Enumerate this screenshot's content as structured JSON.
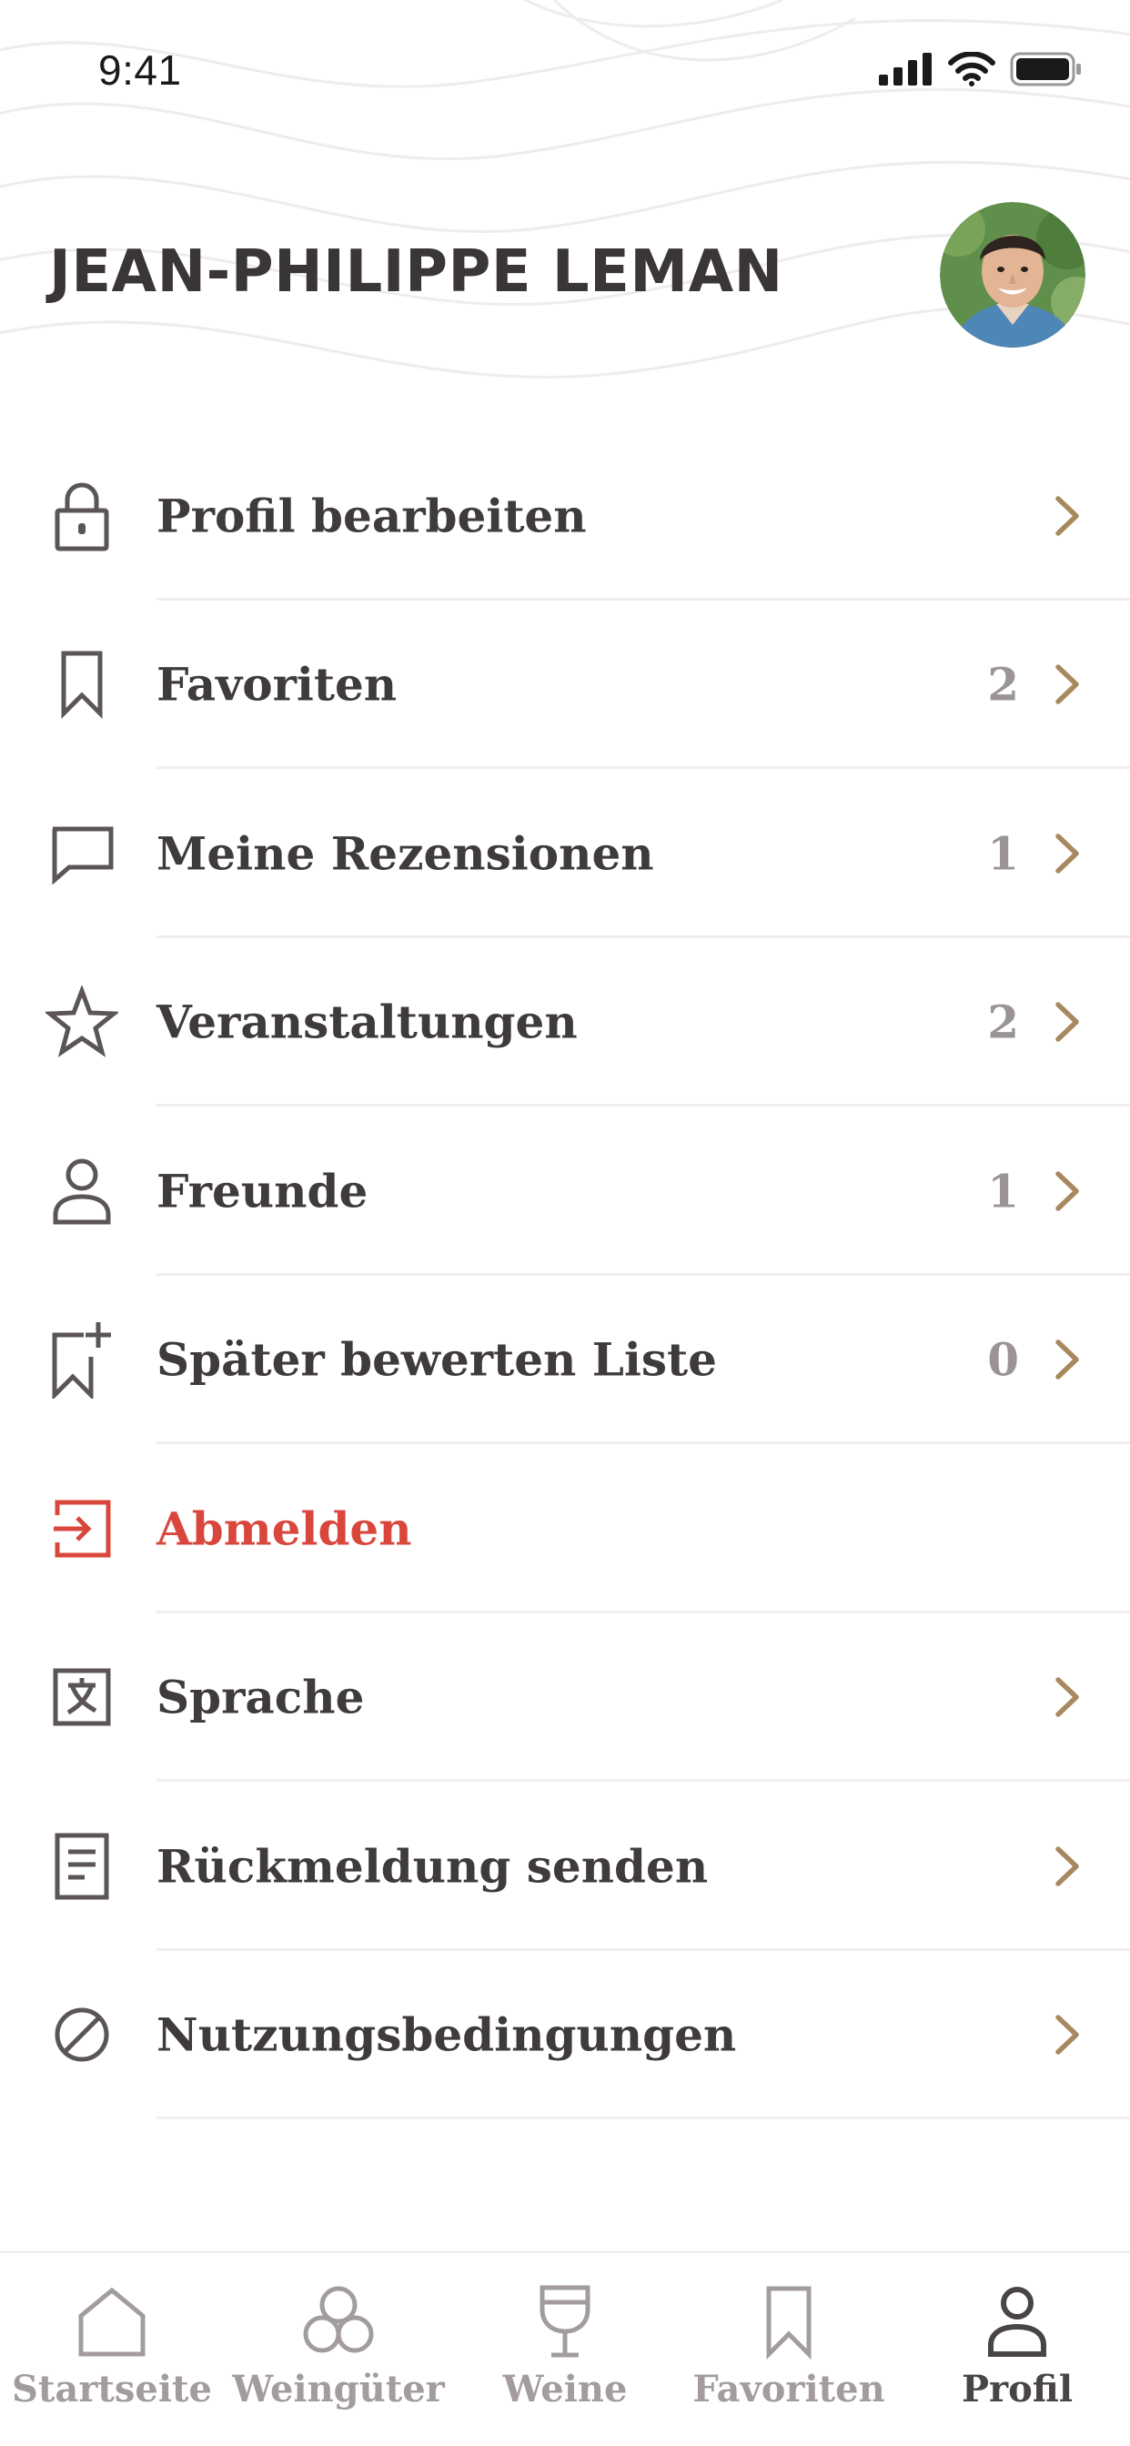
{
  "status_bar": {
    "time": "9:41"
  },
  "header": {
    "name": "JEAN-PHILIPPE LEMAN"
  },
  "menu": [
    {
      "label": "Profil bearbeiten",
      "count": "",
      "icon": "lock-icon",
      "chevron": true
    },
    {
      "label": "Favoriten",
      "count": "2",
      "icon": "bookmark-icon",
      "chevron": true
    },
    {
      "label": "Meine Rezensionen",
      "count": "1",
      "icon": "comment-icon",
      "chevron": true
    },
    {
      "label": "Veranstaltungen",
      "count": "2",
      "icon": "star-icon",
      "chevron": true
    },
    {
      "label": "Freunde",
      "count": "1",
      "icon": "person-icon",
      "chevron": true
    },
    {
      "label": "Später bewerten Liste",
      "count": "0",
      "icon": "bookmark-plus-icon",
      "chevron": true
    },
    {
      "label": "Abmelden",
      "count": "",
      "icon": "logout-icon",
      "chevron": false
    },
    {
      "label": "Sprache",
      "count": "",
      "icon": "translate-icon",
      "chevron": true
    },
    {
      "label": "Rückmeldung senden",
      "count": "",
      "icon": "document-icon",
      "chevron": true
    },
    {
      "label": "Nutzungsbedingungen",
      "count": "",
      "icon": "block-icon",
      "chevron": true
    }
  ],
  "tabs": [
    {
      "label": "Startseite",
      "icon": "home-icon",
      "active": false
    },
    {
      "label": "Weingüter",
      "icon": "grapes-icon",
      "active": false
    },
    {
      "label": "Weine",
      "icon": "wine-glass-icon",
      "active": false
    },
    {
      "label": "Favoriten",
      "icon": "bookmark-icon",
      "active": false
    },
    {
      "label": "Profil",
      "icon": "person-icon",
      "active": true
    }
  ],
  "colors": {
    "text": "#3f3a3b",
    "count": "#9b9494",
    "accent": "#a8895f",
    "danger": "#d9473c",
    "divider": "#f1efee",
    "tab_inactive": "#a39c9c",
    "tab_active": "#4a4545"
  }
}
